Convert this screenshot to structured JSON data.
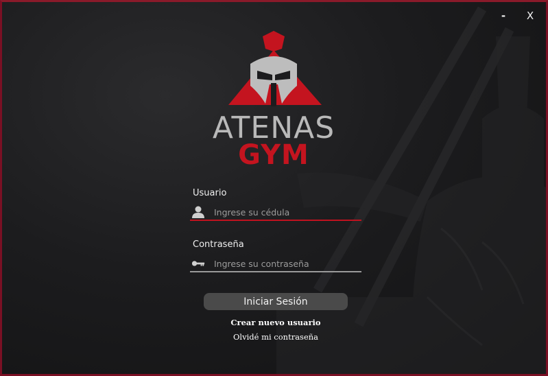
{
  "window": {
    "minimize_label": "-",
    "close_label": "X"
  },
  "logo": {
    "line1": "ATENAS",
    "line2": "GYM"
  },
  "form": {
    "username_label": "Usuario",
    "username_placeholder": "Ingrese su cédula",
    "password_label": "Contraseña",
    "password_placeholder": "Ingrese su contraseña",
    "submit_label": "Iniciar Sesión",
    "create_user_link": "Crear nuevo usuario",
    "forgot_password_link": "Olvidé mi contraseña"
  },
  "colors": {
    "accent": "#c1121f",
    "border": "#7a1024",
    "button": "#4a4a4a"
  },
  "icons": {
    "username": "user-icon",
    "password": "key-icon"
  }
}
